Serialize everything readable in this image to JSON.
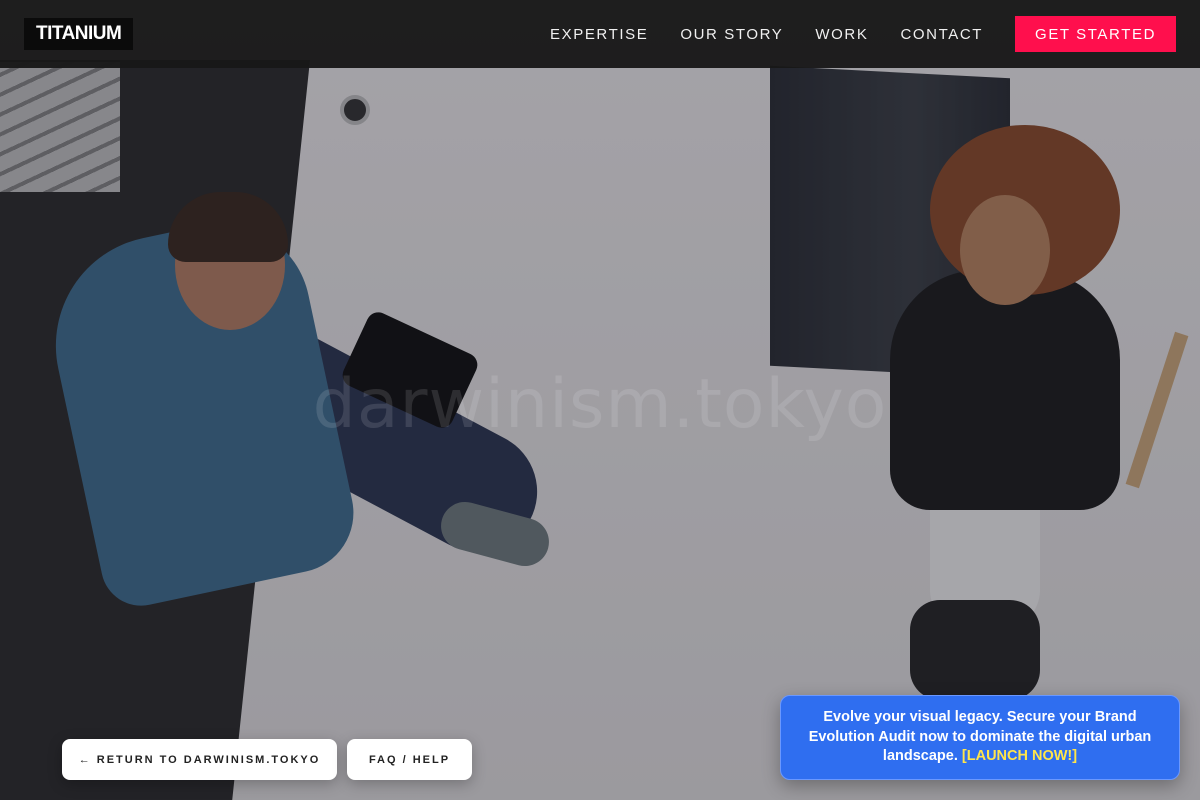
{
  "header": {
    "logo": "TITANIUM",
    "nav": [
      "EXPERTISE",
      "OUR STORY",
      "WORK",
      "CONTACT"
    ],
    "cta_label": "GET STARTED"
  },
  "hero": {
    "watermark": "darwinism.tokyo"
  },
  "footer_buttons": {
    "return_label": "← RETURN TO DARWINISM.TOKYO",
    "faq_label": "FAQ / HELP"
  },
  "promo": {
    "text": "Evolve your visual legacy. Secure your Brand Evolution Audit now to dominate the digital urban landscape.",
    "link_label": "[LAUNCH NOW!]"
  },
  "colors": {
    "cta": "#ff0f4d",
    "promo_bg": "#2f6ef0",
    "promo_link": "#ffe54a",
    "header_bg": "#181818"
  }
}
